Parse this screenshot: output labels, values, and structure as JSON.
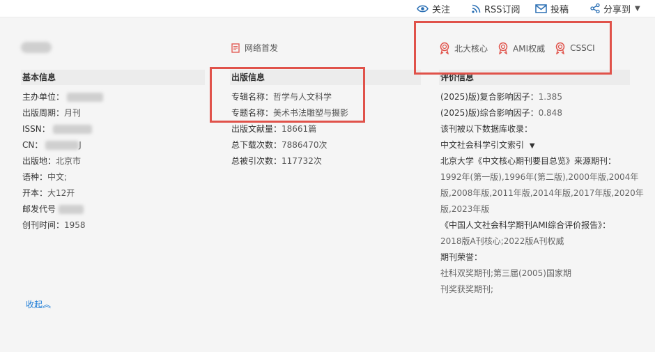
{
  "topbar": {
    "follow": "关注",
    "rss": "RSS订阅",
    "submit": "投稿",
    "share": "分享到"
  },
  "first_pub": "网络首发",
  "badges": [
    "北大核心",
    "AMI权威",
    "CSSCI"
  ],
  "colors": {
    "accent_red": "#e0524a",
    "link_blue": "#1b7bd6",
    "icon_blue": "#2a6fb4"
  },
  "basic": {
    "title": "基本信息",
    "rows": [
      {
        "k": "主办单位：",
        "v": ""
      },
      {
        "k": "出版周期：",
        "v": "月刊"
      },
      {
        "k": "ISSN：",
        "v": ""
      },
      {
        "k": "CN：",
        "v": "J"
      },
      {
        "k": "出版地：",
        "v": "北京市"
      },
      {
        "k": "语种：",
        "v": "中文;"
      },
      {
        "k": "开本：",
        "v": "大12开"
      },
      {
        "k": "邮发代号",
        "v": ""
      },
      {
        "k": "创刊时间：",
        "v": "1958"
      }
    ]
  },
  "publish": {
    "title": "出版信息",
    "rows": [
      {
        "k": "专辑名称：",
        "v": "哲学与人文科学"
      },
      {
        "k": "专题名称：",
        "v": "美术书法雕塑与摄影"
      },
      {
        "k": "出版文献量：",
        "v": "18661篇"
      },
      {
        "k": "总下载次数：",
        "v": "7886470次"
      },
      {
        "k": "总被引次数：",
        "v": "117732次"
      }
    ]
  },
  "evaluation": {
    "title": "评价信息",
    "impact_composite_label": "(2025)版)复合影响因子：",
    "impact_composite_value": "1.385",
    "impact_comprehensive_label": "(2025)版)综合影响因子：",
    "impact_comprehensive_value": "0.848",
    "db_label": "该刊被以下数据库收录：",
    "db_name": "中文社会科学引文索引",
    "pku_label": "北京大学《中文核心期刊要目总览》来源期刊：",
    "pku_line1": "1992年(第一版),1996年(第二版),2000年版,2004年",
    "pku_line2": "版,2008年版,2011年版,2014年版,2017年版,2020年",
    "pku_line3": "版,2023年版",
    "ami_label": "《中国人文社会科学期刊AMI综合评价报告》：",
    "ami_value": "2018版A刊核心;2022版A刊权威",
    "honor_label": "期刊荣誉：",
    "honor_line1": "社科双奖期刊;第三届(2005)国家期",
    "honor_line2": "刊奖获奖期刊;"
  },
  "collapse": "收起︽"
}
